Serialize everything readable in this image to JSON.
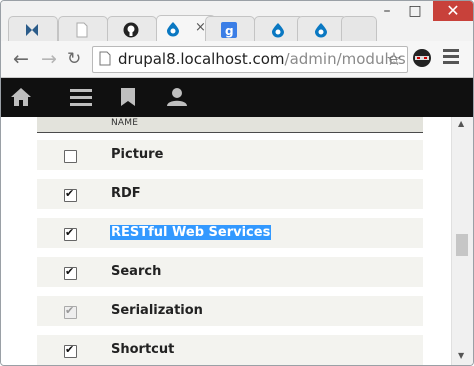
{
  "browser": {
    "tabs": [
      {
        "name": "tab-site-1",
        "icon": "bow-tie-logo-icon",
        "color": "#2b5c8a"
      },
      {
        "name": "tab-blank",
        "icon": "blank-page-icon",
        "color": "#bbbbbb"
      },
      {
        "name": "tab-github",
        "icon": "github-icon",
        "color": "#222222"
      },
      {
        "name": "tab-drupal-active",
        "icon": "drupal-drop-icon",
        "color": "#0a78c2",
        "active": true
      },
      {
        "name": "tab-google",
        "icon": "google-g-icon",
        "color": "#3b7ee6"
      },
      {
        "name": "tab-drupal-2",
        "icon": "drupal-drop-icon",
        "color": "#0a78c2"
      },
      {
        "name": "tab-drupal-3",
        "icon": "drupal-drop-icon",
        "color": "#0a78c2"
      }
    ],
    "tab_close_glyph": "×",
    "window_controls": {
      "minimize": "–",
      "maximize": "□",
      "close": "✕"
    },
    "url_host": "drupal8.localhost.com",
    "url_path": "/admin/modules"
  },
  "adminbar": {
    "icons": [
      "home-icon",
      "menu-icon",
      "bookmark-icon",
      "user-icon"
    ]
  },
  "table": {
    "header_name": "NAME",
    "rows": [
      {
        "name": "Picture",
        "checked": false,
        "disabled": false,
        "selected": false
      },
      {
        "name": "RDF",
        "checked": true,
        "disabled": false,
        "selected": false
      },
      {
        "name": "RESTful Web Services",
        "checked": true,
        "disabled": false,
        "selected": true
      },
      {
        "name": "Search",
        "checked": true,
        "disabled": false,
        "selected": false
      },
      {
        "name": "Serialization",
        "checked": true,
        "disabled": true,
        "selected": false
      },
      {
        "name": "Shortcut",
        "checked": true,
        "disabled": false,
        "selected": false
      }
    ]
  },
  "colors": {
    "adminbar_bg": "#101010",
    "selection": "#3399ff",
    "row_bg": "#f3f3ef",
    "window_close": "#c8413a"
  }
}
